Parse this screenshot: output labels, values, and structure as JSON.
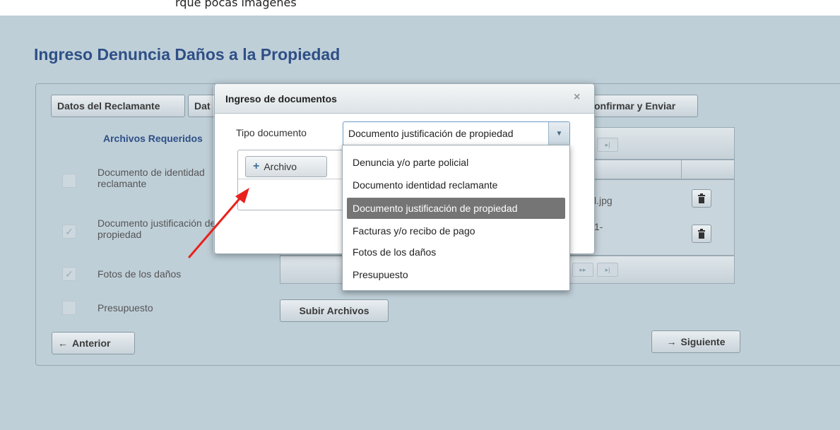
{
  "top_partial_text": "rque pocas imagenes",
  "page_title": "Ingreso Denuncia Daños a la Propiedad",
  "steps": {
    "datos_reclamante": "Datos del Reclamante",
    "second_partial": "Dat",
    "confirmar_partial": "onfirmar y Enviar"
  },
  "required_files": {
    "title": "Archivos Requeridos",
    "items": [
      {
        "line1": "Documento de identidad",
        "line2": "reclamante",
        "checked": false
      },
      {
        "line1": "Documento justificación de",
        "line2": "propiedad",
        "checked": true
      },
      {
        "line1": "Fotos de los daños",
        "line2": "",
        "checked": true
      },
      {
        "line1": "Presupuesto",
        "line2": "",
        "checked": false
      }
    ]
  },
  "files_grid": {
    "rows": [
      {
        "name_partial": "l.jpg"
      },
      {
        "name_partial": "1-"
      }
    ],
    "pager_glyph": "▸|",
    "pager_glyph_bottom": "▸▸",
    "upload_button": "Subir Archivos"
  },
  "nav": {
    "prev_label": "Anterior",
    "next_label": "Siguiente"
  },
  "dialog": {
    "title": "Ingreso de documentos",
    "close_glyph": "×",
    "tipo_label": "Tipo documento",
    "selected_value": "Documento justificación de propiedad",
    "archivo_button": "Archivo",
    "options": [
      "Denuncia y/o parte policial",
      "Documento identidad reclamante",
      "Documento justificación de propiedad",
      "Facturas y/o recibo de pago",
      "Fotos de los daños",
      "Presupuesto"
    ],
    "selected_index": 2
  },
  "colors": {
    "title": "#2e4f86",
    "background": "#bfcfd8",
    "annotation_arrow": "#e8221c",
    "selected_option": "#757575"
  }
}
